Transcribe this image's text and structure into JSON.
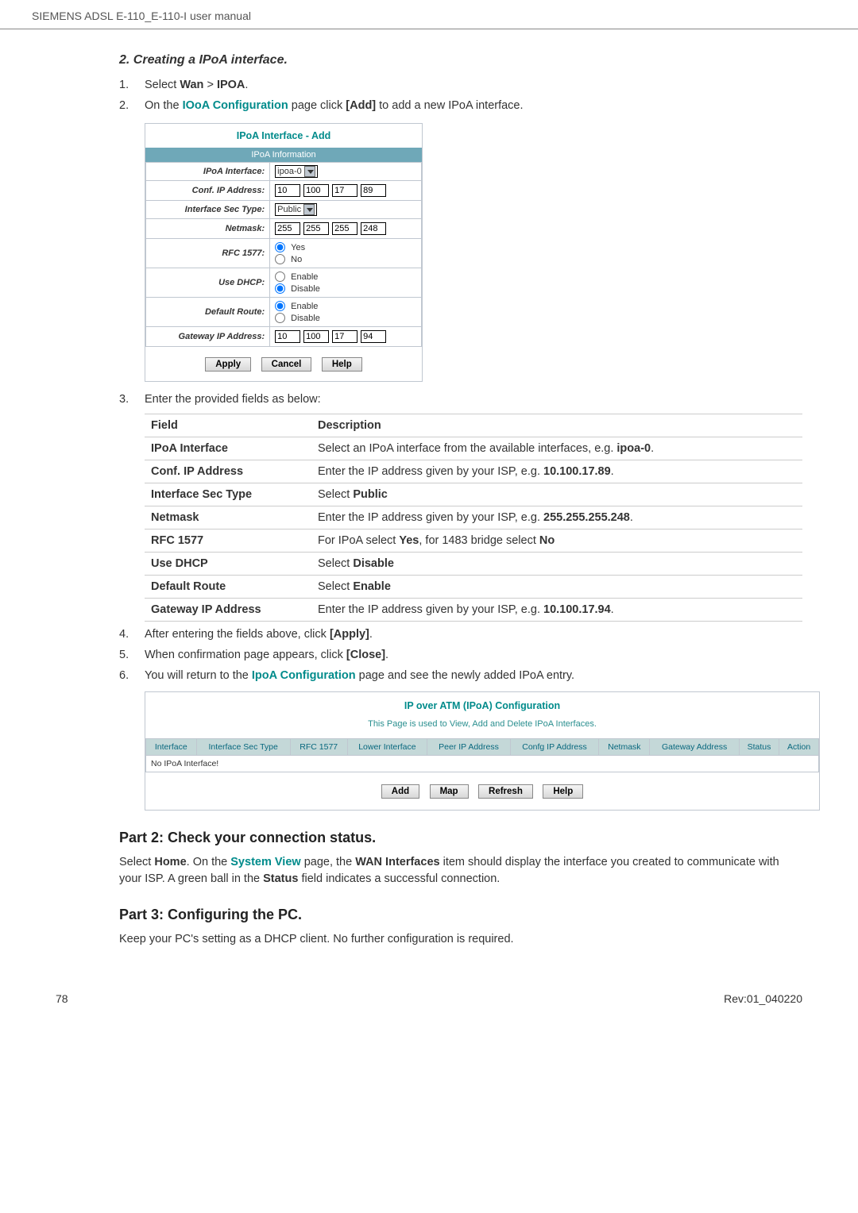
{
  "header": {
    "title": "SIEMENS ADSL E-110_E-110-I user manual"
  },
  "section2": {
    "title": "2. Creating a IPoA interface.",
    "steps": {
      "1": {
        "num": "1.",
        "text_a": "Select ",
        "text_b": "Wan",
        "text_c": " > ",
        "text_d": "IPOA",
        "text_e": "."
      },
      "2": {
        "num": "2.",
        "text_a": "On the ",
        "link": "IOoA Configuration",
        "text_b": " page click ",
        "bold": "[Add]",
        "text_c": " to add a new IPoA interface."
      },
      "3": {
        "num": "3.",
        "text": "Enter the provided fields as below:"
      },
      "4": {
        "num": "4.",
        "text_a": "After entering the fields above, click ",
        "bold": "[Apply]",
        "text_b": "."
      },
      "5": {
        "num": "5.",
        "text_a": "When confirmation page appears, click ",
        "bold": "[Close]",
        "text_b": "."
      },
      "6": {
        "num": "6.",
        "text_a": "You will return to the ",
        "link": "IpoA Configuration",
        "text_b": " page and see the newly added IPoA entry."
      }
    }
  },
  "ipoa_panel": {
    "title": "IPoA Interface - Add",
    "section_label": "IPoA Information",
    "rows": {
      "interface": {
        "label": "IPoA Interface:",
        "value": "ipoa-0"
      },
      "conf_ip": {
        "label": "Conf. IP Address:",
        "oct1": "10",
        "oct2": "100",
        "oct3": "17",
        "oct4": "89"
      },
      "sec_type": {
        "label": "Interface Sec Type:",
        "value": "Public"
      },
      "netmask": {
        "label": "Netmask:",
        "oct1": "255",
        "oct2": "255",
        "oct3": "255",
        "oct4": "248"
      },
      "rfc": {
        "label": "RFC 1577:",
        "opt1": "Yes",
        "opt2": "No",
        "selected": "Yes"
      },
      "dhcp": {
        "label": "Use DHCP:",
        "opt1": "Enable",
        "opt2": "Disable",
        "selected": "Disable"
      },
      "route": {
        "label": "Default Route:",
        "opt1": "Enable",
        "opt2": "Disable",
        "selected": "Enable"
      },
      "gw": {
        "label": "Gateway IP Address:",
        "oct1": "10",
        "oct2": "100",
        "oct3": "17",
        "oct4": "94"
      }
    },
    "buttons": {
      "apply": "Apply",
      "cancel": "Cancel",
      "help": "Help"
    }
  },
  "field_table": {
    "headers": {
      "field": "Field",
      "desc": "Description"
    },
    "rows": [
      {
        "name": "IPoA Interface",
        "pre": "Select an IPoA interface from the available interfaces, e.g. ",
        "bold": "ipoa-0",
        "post": "."
      },
      {
        "name": "Conf. IP Address",
        "pre": "Enter the IP address given by your ISP, e.g. ",
        "bold": "10.100.17.89",
        "post": "."
      },
      {
        "name": "Interface Sec Type",
        "pre": "Select ",
        "bold": "Public",
        "post": ""
      },
      {
        "name": "Netmask",
        "pre": "Enter the IP address given by your ISP, e.g. ",
        "bold": "255.255.255.248",
        "post": "."
      },
      {
        "name": "RFC 1577",
        "pre": "For IPoA select ",
        "bold": "Yes",
        "mid": ", for 1483 bridge select ",
        "bold2": "No",
        "post": ""
      },
      {
        "name": "Use DHCP",
        "pre": "Select ",
        "bold": "Disable",
        "post": ""
      },
      {
        "name": "Default Route",
        "pre": "Select ",
        "bold": "Enable",
        "post": ""
      },
      {
        "name": "Gateway IP Address",
        "pre": "Enter the IP address given by your ISP, e.g. ",
        "bold": "10.100.17.94",
        "post": "."
      }
    ]
  },
  "config_panel": {
    "title": "IP over ATM (IPoA) Configuration",
    "subtitle": "This Page is used to View, Add and Delete IPoA Interfaces.",
    "headers": [
      "Interface",
      "Interface Sec Type",
      "RFC 1577",
      "Lower Interface",
      "Peer IP Address",
      "Confg IP Address",
      "Netmask",
      "Gateway Address",
      "Status",
      "Action"
    ],
    "empty_row": "No IPoA Interface!",
    "buttons": {
      "add": "Add",
      "map": "Map",
      "refresh": "Refresh",
      "help": "Help"
    }
  },
  "part2": {
    "title": "Part 2: Check your connection status.",
    "text_a": "Select ",
    "bold_a": "Home",
    "text_b": ". On the ",
    "link": "System View",
    "text_c": " page, the ",
    "bold_b": "WAN Interfaces",
    "text_d": " item should display the interface you created to communicate with your ISP. A green ball in the ",
    "bold_c": "Status",
    "text_e": " field indicates a successful connection."
  },
  "part3": {
    "title": "Part 3: Configuring the PC.",
    "text": "Keep your PC's setting as a DHCP client. No further configuration is required."
  },
  "footer": {
    "page": "78",
    "rev": "Rev:01_040220"
  }
}
